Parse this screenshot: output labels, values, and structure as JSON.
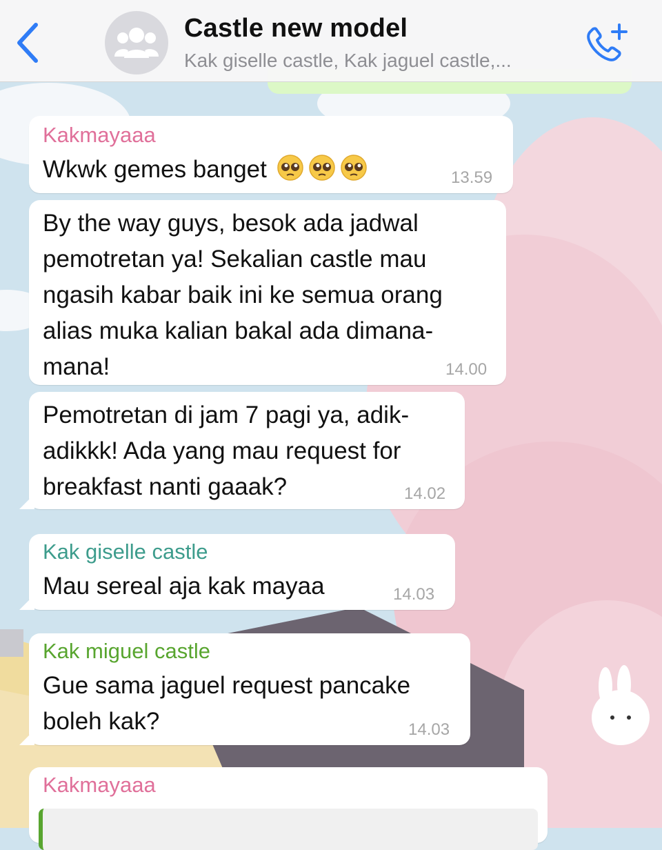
{
  "header": {
    "back_icon": "chevron-left-icon",
    "avatar_icon": "group-icon",
    "title": "Castle new model",
    "subtitle": "Kak giselle castle, Kak jaguel castle,...",
    "call_icon": "add-call-icon"
  },
  "colors": {
    "accent": "#2f7cf6",
    "bubble_in": "#ffffff",
    "bubble_out": "#dcf8c6",
    "sender_kakmayaaa": "#e0709a",
    "sender_giselle": "#3d9c8c",
    "sender_miguel": "#58a52f",
    "timestamp": "#a6a6a6"
  },
  "messages": [
    {
      "sender": "Kakmayaaa",
      "text": "Wkwk gemes banget",
      "emoji": "pleading-face",
      "time": "13.59"
    },
    {
      "sender": "",
      "text": "By the way guys, besok ada jadwal\npemotretan ya! Sekalian castle mau\nngasih kabar baik ini ke semua orang\nalias muka kalian bakal ada dimana-\nmana!",
      "time": "14.00"
    },
    {
      "sender": "",
      "text": "Pemotretan di jam 7 pagi ya, adik-\nadikkk! Ada yang mau request for\nbreakfast nanti gaaak?",
      "time": "14.02"
    },
    {
      "sender": "Kak giselle castle",
      "text": "Mau sereal aja kak mayaa",
      "time": "14.03"
    },
    {
      "sender": "Kak miguel castle",
      "text": "Gue sama jaguel request pancake\nboleh kak?",
      "time": "14.03"
    },
    {
      "sender": "Kakmayaaa",
      "text": "",
      "time": ""
    }
  ]
}
